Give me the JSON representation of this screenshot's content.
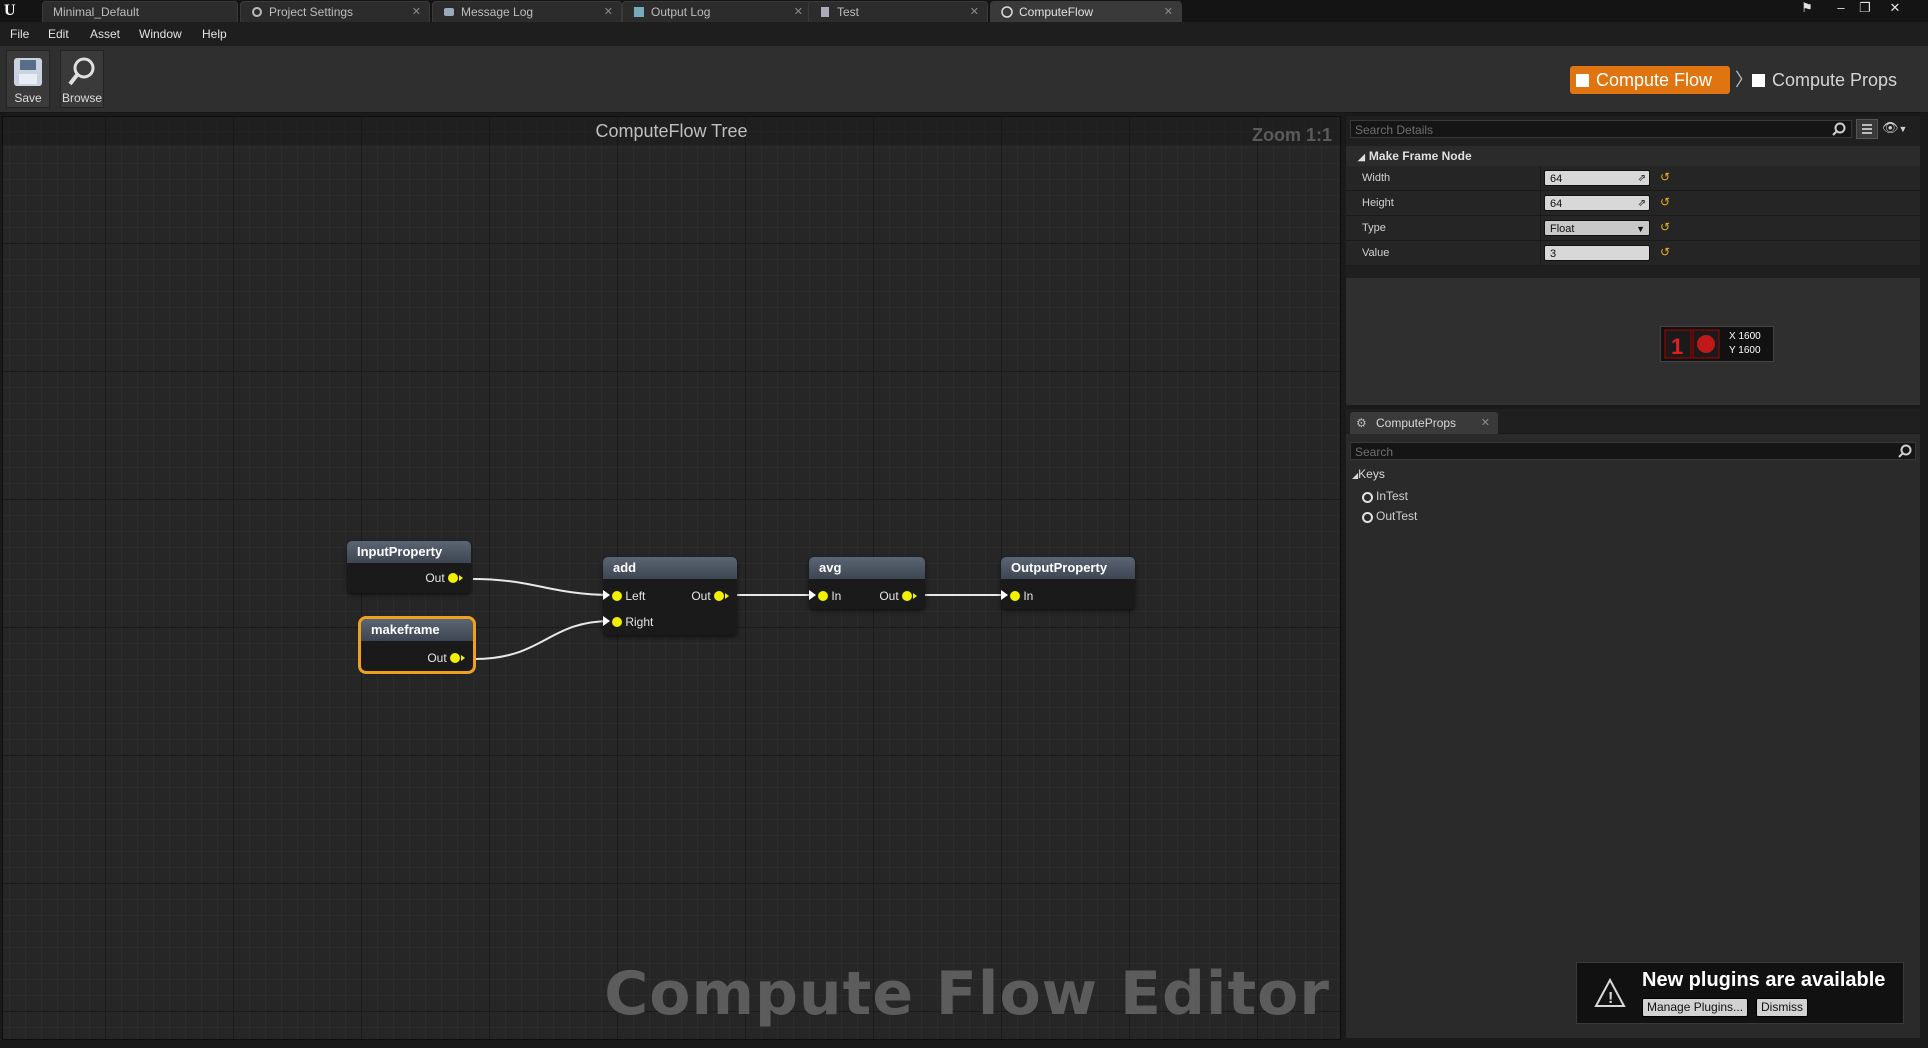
{
  "tabs": [
    {
      "label": "Minimal_Default"
    },
    {
      "label": "Project Settings"
    },
    {
      "label": "Message Log"
    },
    {
      "label": "Output Log"
    },
    {
      "label": "Test"
    },
    {
      "label": "ComputeFlow"
    }
  ],
  "menu": [
    "File",
    "Edit",
    "Asset",
    "Window",
    "Help"
  ],
  "toolbar": {
    "save_label": "Save",
    "browse_label": "Browse"
  },
  "breadcrumb": {
    "flow": "Compute Flow",
    "separator": "〉",
    "props": "Compute Props"
  },
  "graph": {
    "title": "ComputeFlow Tree",
    "zoom": "Zoom 1:1",
    "watermark": "Compute Flow Editor",
    "nodes": [
      {
        "title": "InputProperty",
        "outputs": [
          "Out"
        ]
      },
      {
        "title": "makeframe",
        "outputs": [
          "Out"
        ],
        "selected": true
      },
      {
        "title": "add",
        "inputs": [
          "Left",
          "Right"
        ],
        "outputs": [
          "Out"
        ]
      },
      {
        "title": "avg",
        "inputs": [
          "In"
        ],
        "outputs": [
          "Out"
        ]
      },
      {
        "title": "OutputProperty",
        "inputs": [
          "In"
        ]
      }
    ]
  },
  "details": {
    "search_placeholder": "Search Details",
    "category": "Make Frame Node",
    "properties": [
      {
        "label": "Width",
        "value": "64"
      },
      {
        "label": "Height",
        "value": "64"
      },
      {
        "label": "Type",
        "value": "Float"
      },
      {
        "label": "Value",
        "value": "3"
      }
    ],
    "preview": {
      "x": "X 1600",
      "y": "Y 1600"
    }
  },
  "compute_props": {
    "tab_label": "ComputeProps",
    "search_placeholder": "Search",
    "keys_header": "Keys",
    "keys": [
      "InTest",
      "OutTest"
    ]
  },
  "toast": {
    "title": "New plugins are available",
    "manage_label": "Manage Plugins...",
    "dismiss_label": "Dismiss"
  },
  "colors": {
    "accent": "#e07410",
    "pin": "#f0f000",
    "selection": "#f0a020"
  }
}
